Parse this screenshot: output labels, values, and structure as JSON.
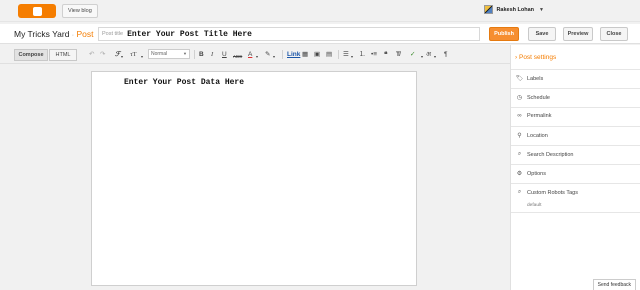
{
  "header": {
    "view_blog": "View blog",
    "user_name": "Rakesh Lohan"
  },
  "titlebar": {
    "blog_name": "My Tricks Yard",
    "separator": "·",
    "section": "Post",
    "post_title_placeholder": "Post title",
    "post_title_value": "Enter Your Post Title Here",
    "publish": "Publish",
    "save": "Save",
    "preview": "Preview",
    "close": "Close"
  },
  "toolbar": {
    "compose": "Compose",
    "html": "HTML",
    "font_size_value": "Normal",
    "bold": "B",
    "italic": "I",
    "underline": "U",
    "strike": "ABC",
    "link": "Link"
  },
  "editor": {
    "content": "Enter Your Post Data Here"
  },
  "sidebar": {
    "title": "Post settings",
    "items": [
      {
        "label": "Labels"
      },
      {
        "label": "Schedule"
      },
      {
        "label": "Permalink"
      },
      {
        "label": "Location"
      },
      {
        "label": "Search Description"
      },
      {
        "label": "Options"
      },
      {
        "label": "Custom Robots Tags"
      }
    ],
    "robots_default": "default"
  },
  "footer": {
    "send_feedback": "Send feedback"
  },
  "colors": {
    "brand_orange": "#f57d00",
    "publish_bg": "#f68e30",
    "link_blue": "#1a55a8"
  }
}
